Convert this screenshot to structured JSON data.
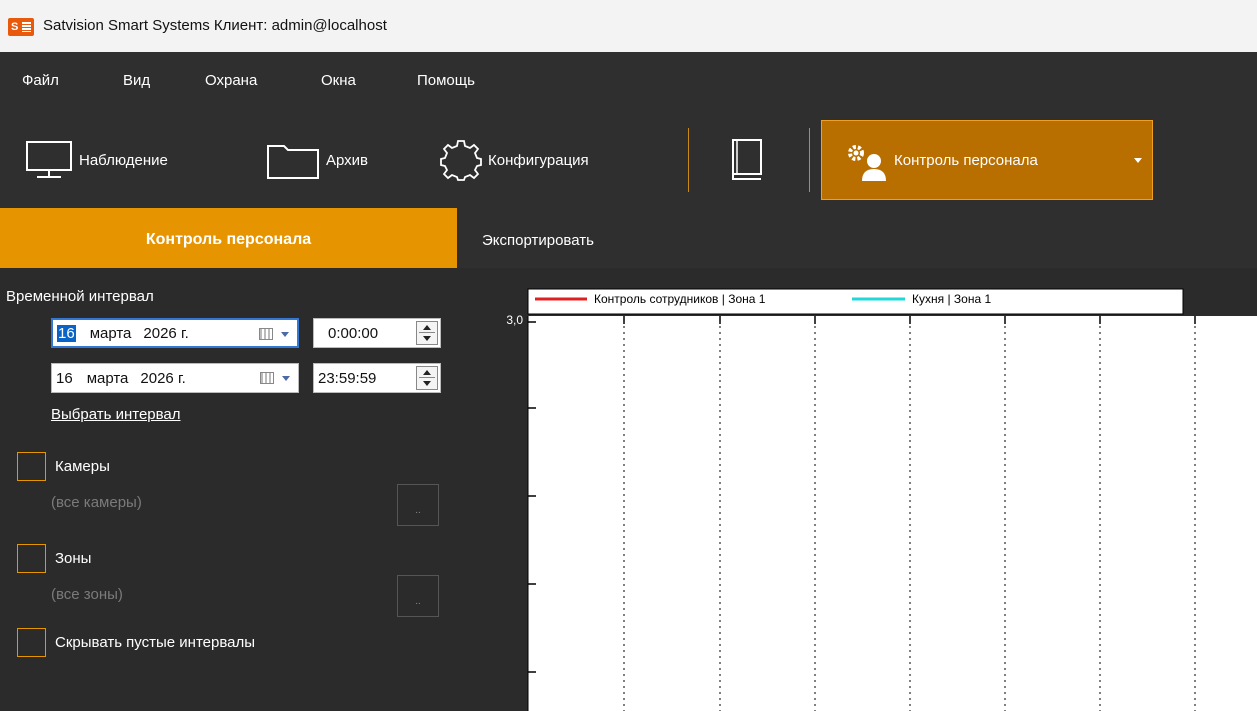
{
  "window": {
    "title": "Satvision Smart Systems Клиент: admin@localhost",
    "logo_letter": "S"
  },
  "menu": [
    "Файл",
    "Вид",
    "Охрана",
    "Окна",
    "Помощь"
  ],
  "toolbar": {
    "observation": "Наблюдение",
    "archive": "Архив",
    "configuration": "Конфигурация",
    "personnel": "Контроль персонала"
  },
  "sidebar": {
    "header": "Контроль персонала",
    "interval_label": "Временной интервал",
    "from": {
      "day": "16",
      "month": "марта",
      "year": "2026 г.",
      "time": "0:00:00"
    },
    "to": {
      "day": "16",
      "month": "марта",
      "year": "2026 г.",
      "time": "23:59:59"
    },
    "select_interval": "Выбрать интервал",
    "cameras_label": "Камеры",
    "cameras_value": "(все камеры)",
    "zones_label": "Зоны",
    "zones_value": "(все зоны)",
    "hide_empty_label": "Скрывать пустые интервалы",
    "dots": ".."
  },
  "content": {
    "export": "Экспортировать"
  },
  "chart_data": {
    "type": "line",
    "series": [
      {
        "name": "Контроль сотрудников | Зона 1",
        "color": "#e02020",
        "values": []
      },
      {
        "name": "Кухня | Зона 1",
        "color": "#20d8d8",
        "values": []
      }
    ],
    "y_tick_labels": [
      "3,0"
    ],
    "grid": true
  },
  "colors": {
    "accent": "#e69500",
    "accent_dark": "#b96e00",
    "background": "#2b2b2b"
  }
}
